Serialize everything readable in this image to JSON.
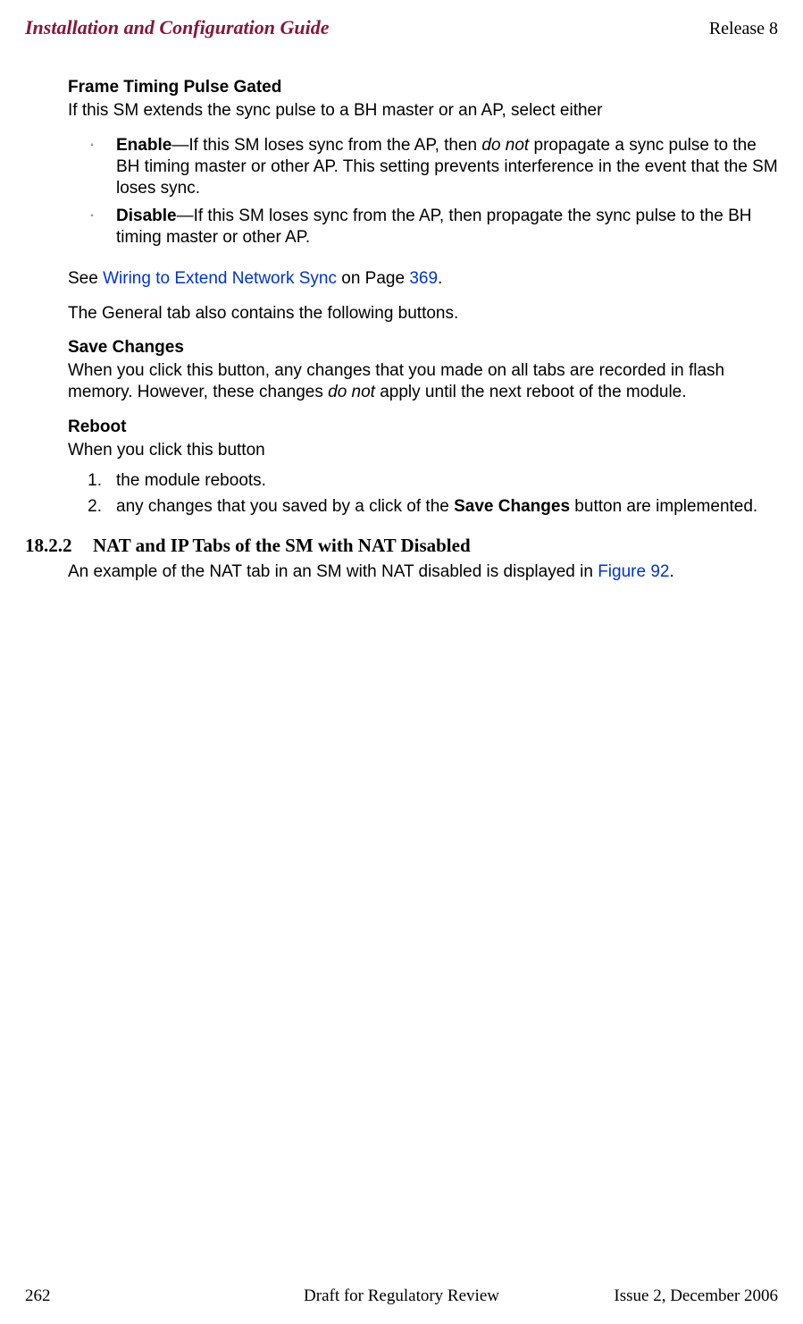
{
  "header": {
    "left": "Installation and Configuration Guide",
    "right": "Release 8"
  },
  "sec1": {
    "title": "Frame Timing Pulse Gated",
    "intro": "If this SM extends the sync pulse to a BH master or an AP, select either",
    "b1_label": "Enable",
    "b1_text": "—If this SM loses sync from the AP, then ",
    "b1_ital": "do not",
    "b1_rest": " propagate a sync pulse to the BH timing master or other AP. This setting prevents interference in the event that the SM loses sync.",
    "b2_label": "Disable",
    "b2_text": "—If this SM loses sync from the AP, then propagate the sync pulse to the BH timing master or other AP."
  },
  "see": {
    "pre": "See ",
    "link": "Wiring to Extend Network Sync",
    "mid": " on Page ",
    "page": "369",
    "post": "."
  },
  "general_note": "The General tab also contains the following buttons.",
  "save": {
    "title": "Save Changes",
    "p_pre": "When you click this button, any changes that you made on all tabs are recorded in flash memory. However, these changes ",
    "p_ital": "do not",
    "p_post": " apply until the next reboot of the module."
  },
  "reboot": {
    "title": "Reboot",
    "intro": "When you click this button",
    "n1": "the module reboots.",
    "n2_pre": "any changes that you saved by a click of the ",
    "n2_bold": "Save Changes",
    "n2_post": " button are implemented."
  },
  "h2": {
    "num": "18.2.2",
    "title": "NAT and IP Tabs of the SM with NAT Disabled",
    "p_pre": "An example of the NAT tab in an SM with NAT disabled is displayed in ",
    "p_link": "Figure 92",
    "p_post": "."
  },
  "footer": {
    "left": "262",
    "center": "Draft for Regulatory Review",
    "right": "Issue 2, December 2006"
  }
}
